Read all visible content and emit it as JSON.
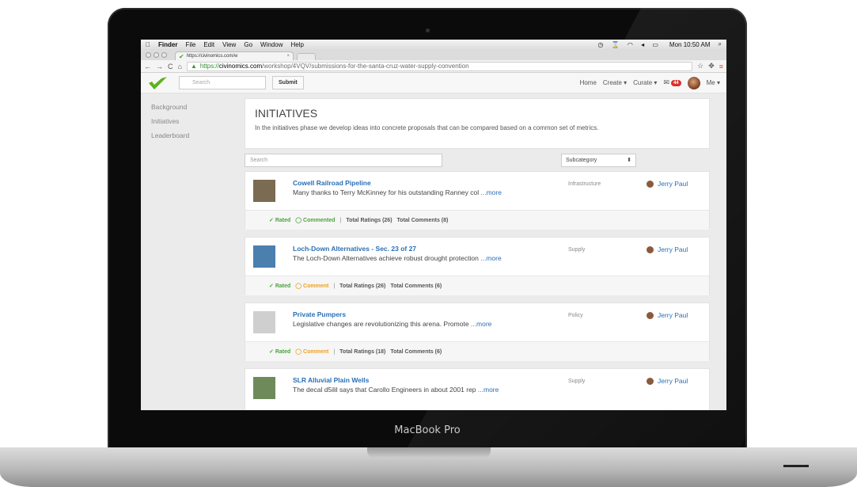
{
  "device": {
    "brand": "MacBook Pro"
  },
  "menubar": {
    "apple": "",
    "app": "Finder",
    "items": [
      "File",
      "Edit",
      "View",
      "Go",
      "Window",
      "Help"
    ],
    "clock": "Mon 10:50 AM"
  },
  "browser": {
    "tab_title": "https://civinomics.com/w",
    "url_scheme": "https://",
    "url_domain": "civinomics.com",
    "url_path": "/workshop/4VQV/submissions-for-the-santa-cruz-water-supply-convention"
  },
  "navbar": {
    "search_placeholder": "Search",
    "submit_label": "Submit",
    "links": [
      "Home",
      "Create ▾",
      "Curate ▾"
    ],
    "mail_count": "44",
    "me_label": "Me ▾"
  },
  "sidebar": {
    "items": [
      "Background",
      "Initiatives",
      "Leaderboard"
    ]
  },
  "intro": {
    "title": "INITIATIVES",
    "description": "In the initiatives phase we develop ideas into concrete proposals that can be compared based on a common set of metrics."
  },
  "filters": {
    "search_placeholder": "Search",
    "subcategory": "Subcategory",
    "subcategory_arrow": "⬍"
  },
  "items": [
    {
      "title": "Cowell Railroad Pipeline",
      "excerpt": "Many thanks to Terry McKinney for his outstanding Ranney col",
      "more": "...more",
      "category": "Infrastructure",
      "author": "Jerry Paul",
      "rated": "Rated",
      "comment_state": "Commented",
      "comment_type": "commented",
      "ratings": "Total Ratings (26)",
      "comments": "Total Comments (8)",
      "thumb_color": "#7a6b52"
    },
    {
      "title": "Loch-Down Alternatives - Sec. 23 of 27",
      "excerpt": "The Loch-Down Alternatives achieve robust drought protection",
      "more": "...more",
      "category": "Supply",
      "author": "Jerry Paul",
      "rated": "Rated",
      "comment_state": "Comment",
      "comment_type": "comment",
      "ratings": "Total Ratings (26)",
      "comments": "Total Comments (6)",
      "thumb_color": "#4a7fae"
    },
    {
      "title": "Private Pumpers",
      "excerpt": "Legislative changes are revolutionizing this arena. Promote",
      "more": "...more",
      "category": "Policy",
      "author": "Jerry Paul",
      "rated": "Rated",
      "comment_state": "Comment",
      "comment_type": "comment",
      "ratings": "Total Ratings (18)",
      "comments": "Total Comments (6)",
      "thumb_color": "#cfcfcf"
    },
    {
      "title": "SLR Alluvial Plain Wells",
      "excerpt": "The decal d5ilil says that Carollo Engineers in about 2001 rep",
      "more": "...more",
      "category": "Supply",
      "author": "Jerry Paul",
      "rated": "",
      "comment_state": "",
      "comment_type": "comment",
      "ratings": "",
      "comments": "",
      "thumb_color": "#6f8a5a"
    }
  ]
}
